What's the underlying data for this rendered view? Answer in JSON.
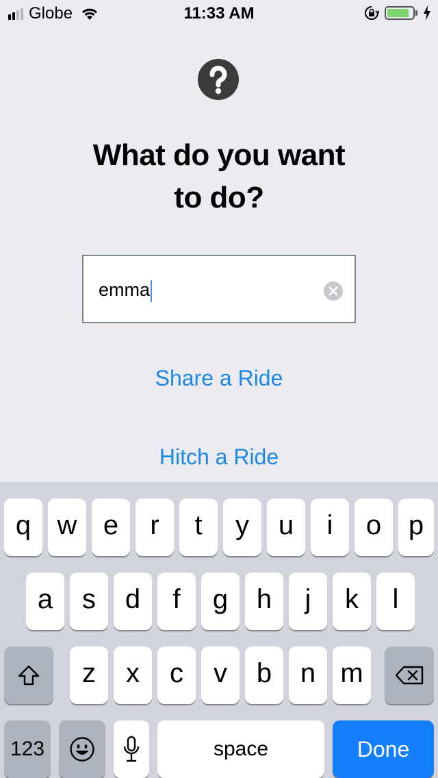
{
  "status_bar": {
    "carrier": "Globe",
    "time": "11:33 AM",
    "signal_bars_active": 2,
    "signal_bars_total": 4,
    "battery_level": 0.85,
    "battery_color": "#7ed46d"
  },
  "main": {
    "help_icon": "question-circle-icon",
    "title_line1": "What do you want",
    "title_line2": "to do?",
    "input_value": "emma",
    "clear_icon": "clear-x-icon",
    "share_label": "Share a Ride",
    "hitch_label": "Hitch a Ride",
    "link_color": "#1e88e8"
  },
  "keyboard": {
    "row1": [
      "q",
      "w",
      "e",
      "r",
      "t",
      "y",
      "u",
      "i",
      "o",
      "p"
    ],
    "row2": [
      "a",
      "s",
      "d",
      "f",
      "g",
      "h",
      "j",
      "k",
      "l"
    ],
    "row3": [
      "z",
      "x",
      "c",
      "v",
      "b",
      "n",
      "m"
    ],
    "shift_icon": "shift-icon",
    "delete_icon": "backspace-icon",
    "numbers_label": "123",
    "emoji_icon": "emoji-icon",
    "mic_icon": "microphone-icon",
    "space_label": "space",
    "done_label": "Done",
    "done_color": "#157efb"
  }
}
